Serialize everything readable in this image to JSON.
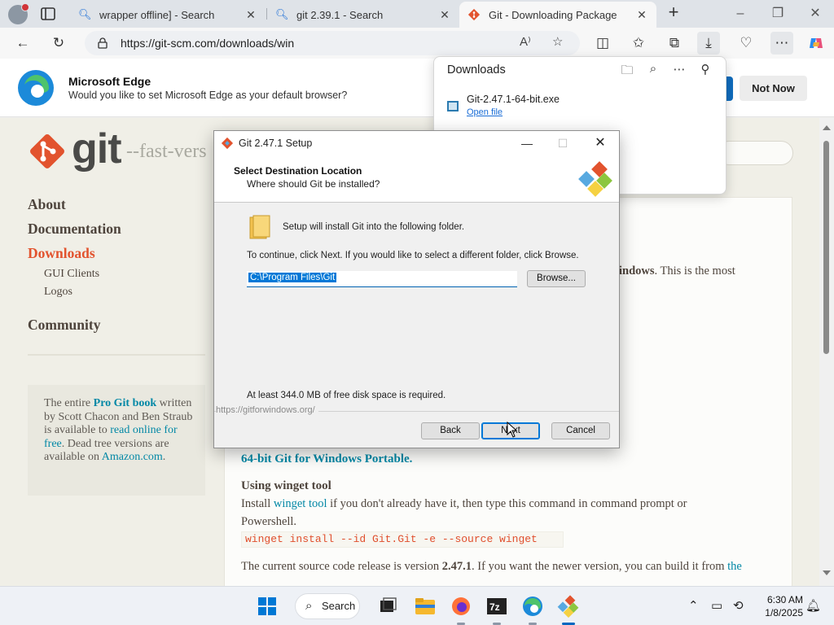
{
  "browser": {
    "tabs": [
      {
        "label": "wrapper offline] - Search",
        "icon": "search-icon"
      },
      {
        "label": "git 2.39.1 - Search",
        "icon": "search-icon"
      },
      {
        "label": "Git - Downloading Package",
        "icon": "git-icon",
        "active": true
      }
    ],
    "url": "https://git-scm.com/downloads/win"
  },
  "infobar": {
    "title": "Microsoft Edge",
    "text": "Would you like to set Microsoft Edge as your default browser?",
    "not_now": "Not Now"
  },
  "downloads": {
    "title": "Downloads",
    "file_name": "Git-2.47.1-64-bit.exe",
    "open_file": "Open file"
  },
  "site": {
    "logo_word": "git",
    "tagline": "--fast-vers",
    "nav": [
      "About",
      "Documentation",
      "Downloads",
      "Community"
    ],
    "subnav": [
      "GUI Clients",
      "Logos"
    ],
    "book": {
      "p1": "The entire ",
      "link1": "Pro Git book",
      "p2": " written by Scott Chacon and Ben Straub is available to ",
      "link2": "read online for free",
      "p3": ". Dead tree versions are available on ",
      "link3": "Amazon.com",
      "p4": "."
    },
    "content": {
      "windows_bold": "indows",
      "windows_rest": ". This is the most",
      "portable_link": "64-bit Git for Windows Portable.",
      "winget_heading": "Using winget tool",
      "install_pre": "Install ",
      "winget_link": "winget tool",
      "install_post": " if you don't already have it, then type this command in command prompt or",
      "powershell": "Powershell.",
      "command": "winget install --id Git.Git -e --source winget",
      "release_pre": "The current source code release is version ",
      "release_version": "2.47.1",
      "release_post": ". If you want the newer version, you can build it from ",
      "release_link": "the"
    }
  },
  "setup": {
    "title": "Git 2.47.1 Setup",
    "header_title": "Select Destination Location",
    "header_sub": "Where should Git be installed?",
    "line1": "Setup will install Git into the following folder.",
    "line2": "To continue, click Next. If you would like to select a different folder, click Browse.",
    "path": "C:\\Program Files\\Git",
    "browse": "Browse...",
    "disk_space": "At least 344.0 MB of free disk space is required.",
    "footer_url": "https://gitforwindows.org/",
    "back": "Back",
    "next": "Next",
    "cancel": "Cancel"
  },
  "taskbar": {
    "search": "Search",
    "time": "6:30 AM",
    "date": "1/8/2025"
  },
  "colors": {
    "git_orange": "#e2532e",
    "link_teal": "#0388a6",
    "win_blue": "#0078d7"
  }
}
